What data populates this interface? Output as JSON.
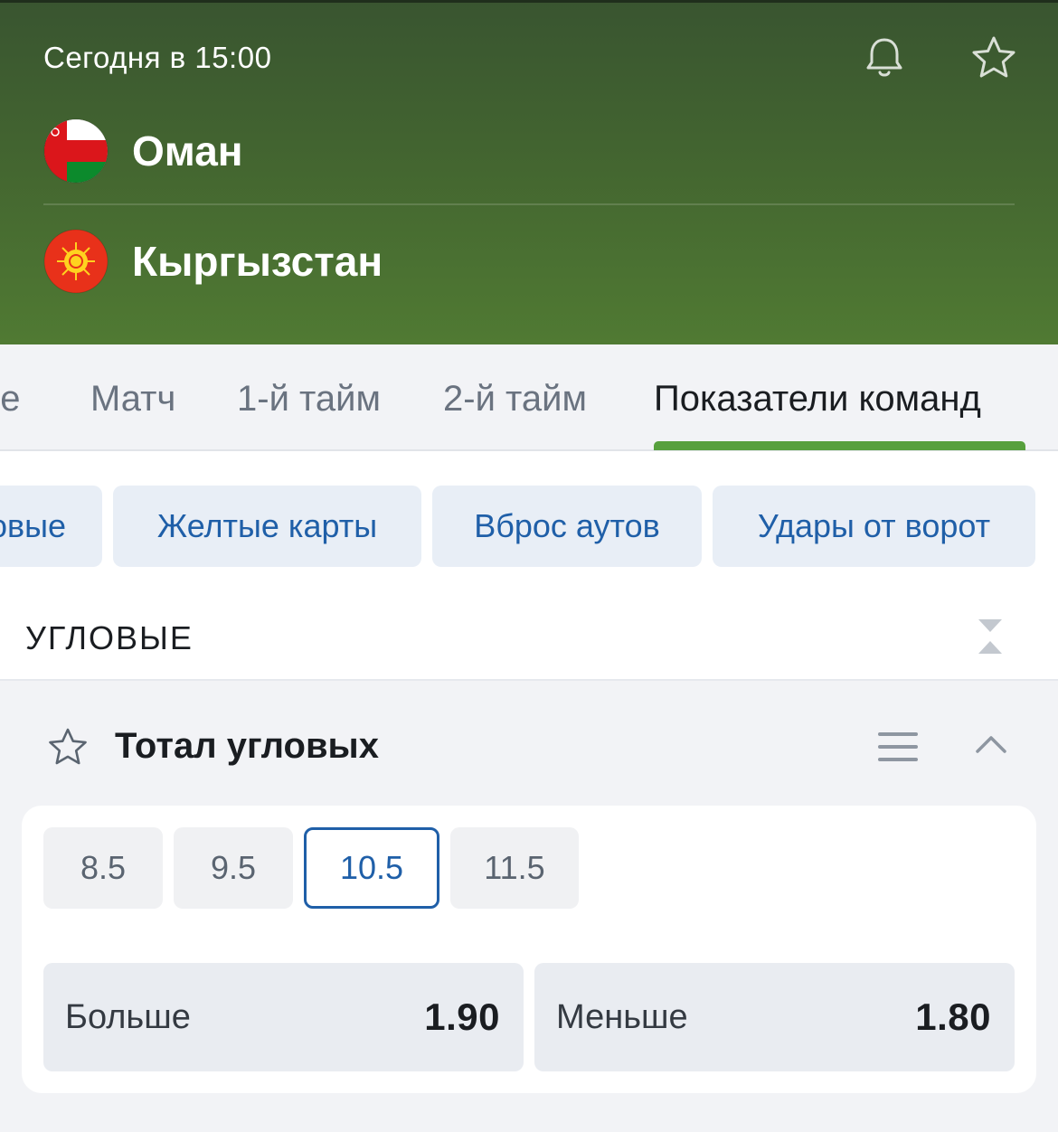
{
  "header": {
    "datetime": "Сегодня в 15:00",
    "team1": {
      "name": "Оман",
      "flag": "oman-flag"
    },
    "team2": {
      "name": "Кыргызстан",
      "flag": "kyrgyzstan-flag"
    }
  },
  "tabs": [
    {
      "label": "ре"
    },
    {
      "label": "Матч"
    },
    {
      "label": "1-й тайм"
    },
    {
      "label": "2-й тайм"
    },
    {
      "label": "Показатели команд",
      "active": true
    }
  ],
  "chips": [
    {
      "label": "овые"
    },
    {
      "label": "Желтые карты"
    },
    {
      "label": "Вброс аутов"
    },
    {
      "label": "Удары от ворот"
    }
  ],
  "section": {
    "title": "УГЛОВЫЕ"
  },
  "market": {
    "title": "Тотал угловых",
    "lines": [
      {
        "value": "8.5"
      },
      {
        "value": "9.5"
      },
      {
        "value": "10.5",
        "selected": true
      },
      {
        "value": "11.5"
      }
    ],
    "odds": [
      {
        "label": "Больше",
        "value": "1.90"
      },
      {
        "label": "Меньше",
        "value": "1.80"
      }
    ]
  },
  "colors": {
    "header_green": "#436530",
    "accent_blue": "#1f5fa8",
    "tab_underline": "#57a03d"
  }
}
